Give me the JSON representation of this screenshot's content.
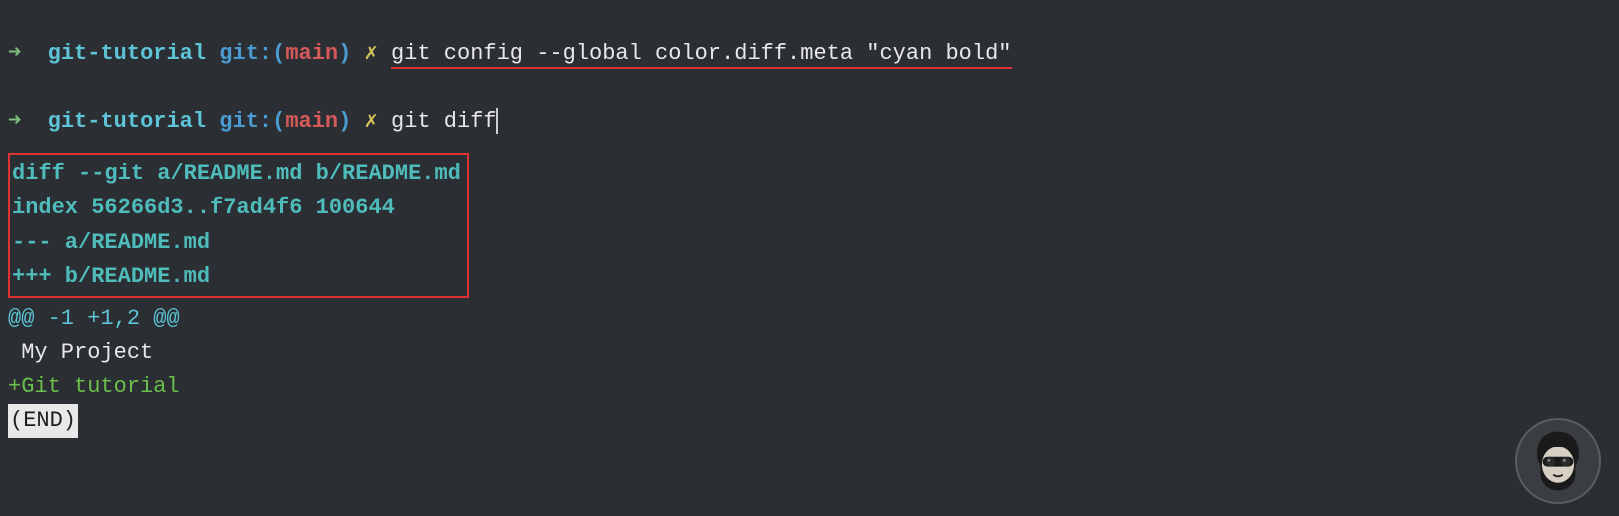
{
  "prompt1": {
    "arrow": "➜  ",
    "dir": "git-tutorial",
    "gitlabel": " git:(",
    "branch": "main",
    "gitclose": ")",
    "dirty": " ✗ ",
    "command": "git config --global color.diff.meta \"cyan bold\""
  },
  "prompt2": {
    "arrow": "➜  ",
    "dir": "git-tutorial",
    "gitlabel": " git:(",
    "branch": "main",
    "gitclose": ")",
    "dirty": " ✗ ",
    "command": "git diff"
  },
  "diff": {
    "meta": [
      "diff --git a/README.md b/README.md",
      "index 56266d3..f7ad4f6 100644",
      "--- a/README.md",
      "+++ b/README.md"
    ],
    "hunk": "@@ -1 +1,2 @@",
    "context": " My Project",
    "added": "+Git tutorial"
  },
  "pager_end": "(END)"
}
